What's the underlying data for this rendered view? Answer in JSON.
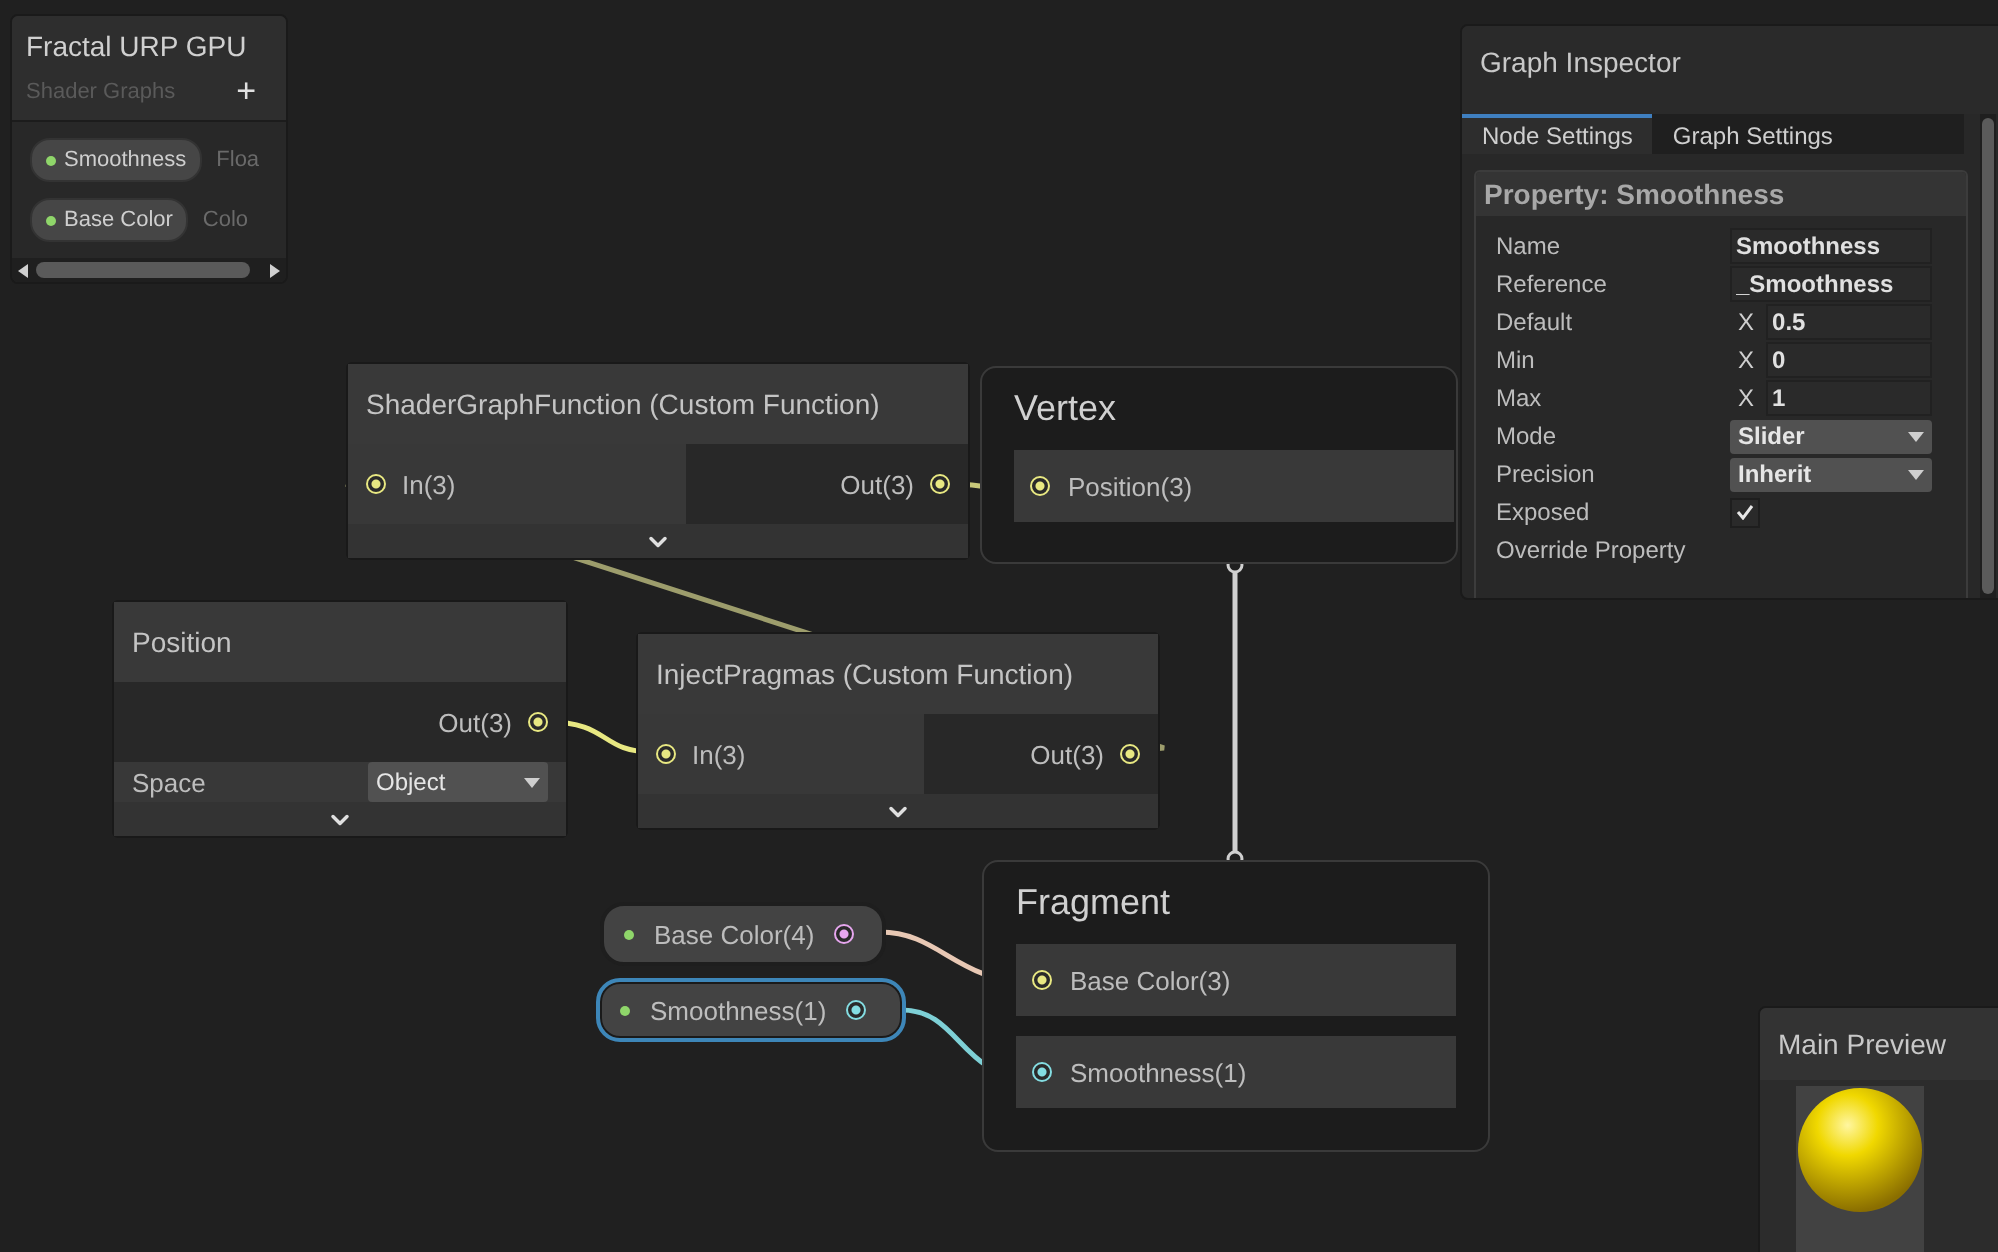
{
  "blackboard": {
    "title": "Fractal URP GPU",
    "subtitle": "Shader Graphs",
    "add": "+",
    "properties": [
      {
        "name": "Smoothness",
        "type": "Floa"
      },
      {
        "name": "Base Color",
        "type": "Colo"
      }
    ]
  },
  "function_nodes": [
    {
      "title": "ShaderGraphFunction (Custom Function)",
      "input": "In(3)",
      "output": "Out(3)"
    },
    {
      "title": "InjectPragmas (Custom Function)",
      "input": "In(3)",
      "output": "Out(3)"
    }
  ],
  "position_node": {
    "title": "Position",
    "output": "Out(3)",
    "space_label": "Space",
    "space_value": "Object"
  },
  "vertex": {
    "title": "Vertex",
    "ports": [
      {
        "label": "Position(3)",
        "color": "#e8e882"
      }
    ]
  },
  "fragment": {
    "title": "Fragment",
    "ports": [
      {
        "label": "Base Color(3)",
        "color": "#e8e882"
      },
      {
        "label": "Smoothness(1)",
        "color": "#84dde2"
      }
    ]
  },
  "property_nodes": [
    {
      "label": "Base Color(4)",
      "selected": false,
      "color": "#e6a6ee"
    },
    {
      "label": "Smoothness(1)",
      "selected": true,
      "color": "#84dde2"
    }
  ],
  "inspector": {
    "title": "Graph Inspector",
    "tabs": [
      {
        "label": "Node Settings",
        "selected": true
      },
      {
        "label": "Graph Settings",
        "selected": false
      }
    ],
    "section": "Property: Smoothness",
    "fields": [
      {
        "kind": "text",
        "label": "Name",
        "value": "Smoothness"
      },
      {
        "kind": "text",
        "label": "Reference",
        "value": "_Smoothness"
      },
      {
        "kind": "vector",
        "label": "Default",
        "axis": "X",
        "value": "0.5"
      },
      {
        "kind": "vector",
        "label": "Min",
        "axis": "X",
        "value": "0"
      },
      {
        "kind": "vector",
        "label": "Max",
        "axis": "X",
        "value": "1"
      },
      {
        "kind": "dropdown",
        "label": "Mode",
        "value": "Slider"
      },
      {
        "kind": "dropdown",
        "label": "Precision",
        "value": "Inherit"
      },
      {
        "kind": "checkbox",
        "label": "Exposed",
        "checked": true
      },
      {
        "kind": "label",
        "label": "Override Property"
      }
    ]
  },
  "preview": {
    "title": "Main Preview"
  }
}
